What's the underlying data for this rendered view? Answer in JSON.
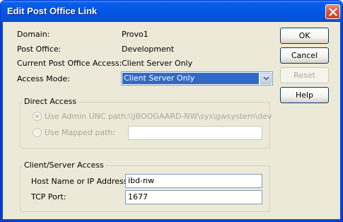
{
  "window": {
    "title": "Edit Post Office Link"
  },
  "info": {
    "domain_label": "Domain:",
    "domain_value": "Provo1",
    "post_office_label": "Post Office:",
    "post_office_value": "Development",
    "current_access_label": "Current Post Office Access:",
    "current_access_value": "Client Server Only",
    "access_mode_label": "Access Mode:",
    "access_mode_value": "Client Server Only"
  },
  "direct_access": {
    "title": "Direct Access",
    "admin_unc_label": "Use Admin UNC path:",
    "admin_unc_value": "\\\\JBOOGAARD-NW\\sys\\gwsystem\\dev",
    "mapped_path_label": "Use Mapped path:",
    "mapped_path_value": ""
  },
  "client_server": {
    "title": "Client/Server Access",
    "host_label": "Host Name or IP Address:",
    "host_value": "ibd-nw",
    "port_label": "TCP Port:",
    "port_value": "1677"
  },
  "buttons": {
    "ok": "OK",
    "cancel": "Cancel",
    "reset": "Reset",
    "help": "Help"
  }
}
